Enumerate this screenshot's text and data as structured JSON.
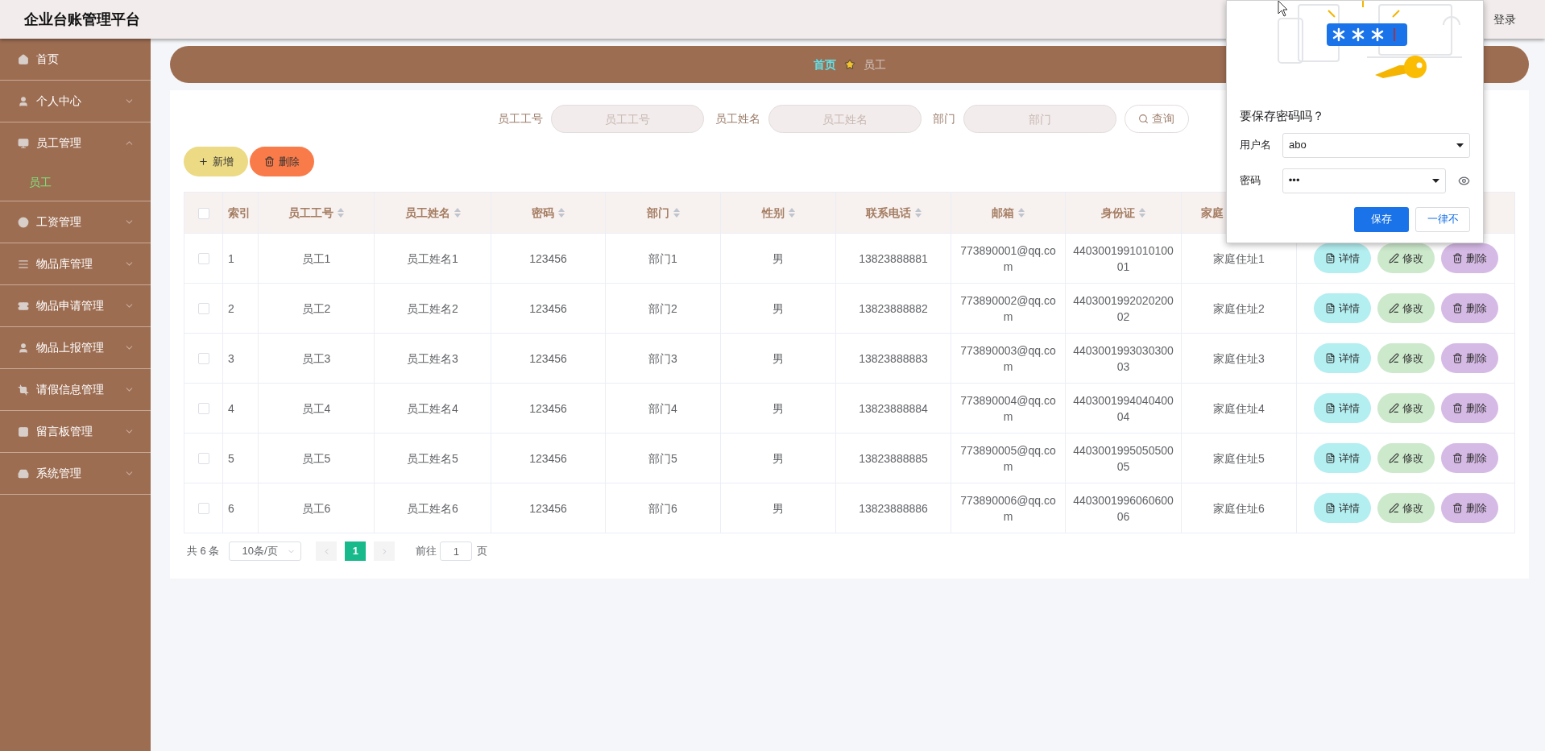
{
  "header": {
    "title": "企业台账管理平台",
    "logout": "登录"
  },
  "sidebar": {
    "items": [
      {
        "label": "首页"
      },
      {
        "label": "个人中心",
        "expanded": false
      },
      {
        "label": "员工管理",
        "expanded": true,
        "children": [
          {
            "label": "员工",
            "selected": true
          }
        ]
      },
      {
        "label": "工资管理",
        "expanded": false
      },
      {
        "label": "物品库管理",
        "expanded": false
      },
      {
        "label": "物品申请管理",
        "expanded": false
      },
      {
        "label": "物品上报管理",
        "expanded": false
      },
      {
        "label": "请假信息管理",
        "expanded": false
      },
      {
        "label": "留言板管理",
        "expanded": false
      },
      {
        "label": "系统管理",
        "expanded": false
      }
    ]
  },
  "breadcrumb": [
    {
      "label": "首页",
      "current": false
    },
    {
      "label": "员工",
      "current": true
    }
  ],
  "search": {
    "fields": [
      {
        "label": "员工工号",
        "placeholder": "员工工号"
      },
      {
        "label": "员工姓名",
        "placeholder": "员工姓名"
      },
      {
        "label": "部门",
        "placeholder": "部门"
      }
    ],
    "button": "查询"
  },
  "toolbar": [
    {
      "kind": "add",
      "label": "新增"
    },
    {
      "kind": "delete",
      "label": "删除"
    }
  ],
  "table": {
    "select_all": {
      "checked": false
    },
    "columns": [
      {
        "label": "索引",
        "sortable": false
      },
      {
        "label": "员工工号",
        "sortable": true
      },
      {
        "label": "员工姓名",
        "sortable": true
      },
      {
        "label": "密码",
        "sortable": true
      },
      {
        "label": "部门",
        "sortable": true
      },
      {
        "label": "性别",
        "sortable": true
      },
      {
        "label": "联系电话",
        "sortable": true
      },
      {
        "label": "邮箱",
        "sortable": true
      },
      {
        "label": "身份证",
        "sortable": true
      },
      {
        "label": "家庭"
      }
    ],
    "rows": [
      {
        "checked": false,
        "cells": [
          "1",
          "员工1",
          "员工姓名1",
          "123456",
          "部门1",
          "男",
          "13823888881",
          "773890001@qq.com",
          "440300199101010001",
          "家庭住址1"
        ],
        "actions": [
          {
            "kind": "detail",
            "label": "详情"
          },
          {
            "kind": "edit",
            "label": "修改"
          },
          {
            "kind": "delete",
            "label": "删除"
          }
        ]
      },
      {
        "checked": false,
        "cells": [
          "2",
          "员工2",
          "员工姓名2",
          "123456",
          "部门2",
          "男",
          "13823888882",
          "773890002@qq.com",
          "440300199202020002",
          "家庭住址2"
        ],
        "actions": [
          {
            "kind": "detail",
            "label": "详情"
          },
          {
            "kind": "edit",
            "label": "修改"
          },
          {
            "kind": "delete",
            "label": "删除"
          }
        ]
      },
      {
        "checked": false,
        "cells": [
          "3",
          "员工3",
          "员工姓名3",
          "123456",
          "部门3",
          "男",
          "13823888883",
          "773890003@qq.com",
          "440300199303030003",
          "家庭住址3"
        ],
        "actions": [
          {
            "kind": "detail",
            "label": "详情"
          },
          {
            "kind": "edit",
            "label": "修改"
          },
          {
            "kind": "delete",
            "label": "删除"
          }
        ]
      },
      {
        "checked": false,
        "cells": [
          "4",
          "员工4",
          "员工姓名4",
          "123456",
          "部门4",
          "男",
          "13823888884",
          "773890004@qq.com",
          "440300199404040004",
          "家庭住址4"
        ],
        "actions": [
          {
            "kind": "detail",
            "label": "详情"
          },
          {
            "kind": "edit",
            "label": "修改"
          },
          {
            "kind": "delete",
            "label": "删除"
          }
        ]
      },
      {
        "checked": false,
        "cells": [
          "5",
          "员工5",
          "员工姓名5",
          "123456",
          "部门5",
          "男",
          "13823888885",
          "773890005@qq.com",
          "440300199505050005",
          "家庭住址5"
        ],
        "actions": [
          {
            "kind": "detail",
            "label": "详情"
          },
          {
            "kind": "edit",
            "label": "修改"
          },
          {
            "kind": "delete",
            "label": "删除"
          }
        ]
      },
      {
        "checked": false,
        "cells": [
          "6",
          "员工6",
          "员工姓名6",
          "123456",
          "部门6",
          "男",
          "13823888886",
          "773890006@qq.com",
          "440300199606060006",
          "家庭住址6"
        ],
        "actions": [
          {
            "kind": "detail",
            "label": "详情"
          },
          {
            "kind": "edit",
            "label": "修改"
          },
          {
            "kind": "delete",
            "label": "删除"
          }
        ]
      }
    ]
  },
  "pagination": {
    "total": "共 6 条",
    "page_size": "10条/页",
    "pages": [
      {
        "label": "1",
        "selected": true
      }
    ],
    "goto_label": "前往",
    "goto_value": "1",
    "goto_suffix": "页"
  },
  "password_dialog": {
    "title": "要保存密码吗？",
    "username_label": "用户名",
    "username": "abo",
    "password_label": "密码",
    "password": "•••",
    "save": "保存",
    "never": "一律不"
  }
}
